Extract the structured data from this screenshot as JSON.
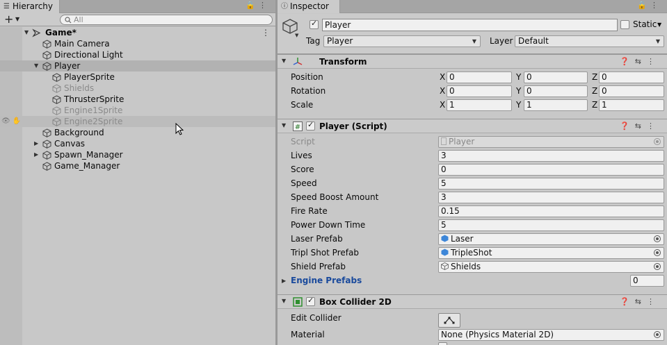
{
  "hierarchy": {
    "tab_label": "Hierarchy",
    "search_placeholder": "All",
    "scene": "Game*",
    "items": [
      {
        "label": "Main Camera"
      },
      {
        "label": "Directional Light"
      },
      {
        "label": "Player"
      },
      {
        "label": "PlayerSprite"
      },
      {
        "label": "Shields"
      },
      {
        "label": "ThrusterSprite"
      },
      {
        "label": "Engine1Sprite"
      },
      {
        "label": "Engine2Sprite"
      },
      {
        "label": "Background"
      },
      {
        "label": "Canvas"
      },
      {
        "label": "Spawn_Manager"
      },
      {
        "label": "Game_Manager"
      }
    ]
  },
  "inspector": {
    "tab_label": "Inspector",
    "object_name": "Player",
    "static_label": "Static",
    "tag_label": "Tag",
    "tag_value": "Player",
    "layer_label": "Layer",
    "layer_value": "Default",
    "transform": {
      "title": "Transform",
      "position_label": "Position",
      "rotation_label": "Rotation",
      "scale_label": "Scale",
      "axis_x": "X",
      "axis_y": "Y",
      "axis_z": "Z",
      "position": [
        "0",
        "0",
        "0"
      ],
      "rotation": [
        "0",
        "0",
        "0"
      ],
      "scale": [
        "1",
        "1",
        "1"
      ]
    },
    "player_script": {
      "title": "Player (Script)",
      "script_label": "Script",
      "script_value": "Player",
      "lives_label": "Lives",
      "lives": "3",
      "score_label": "Score",
      "score": "0",
      "speed_label": "Speed",
      "speed": "5",
      "speed_boost_label": "Speed Boost Amount",
      "speed_boost": "3",
      "fire_rate_label": "Fire Rate",
      "fire_rate": "0.15",
      "power_down_label": "Power Down Time",
      "power_down": "5",
      "laser_prefab_label": "Laser Prefab",
      "laser_prefab": "Laser",
      "tripl_shot_label": "Tripl Shot Prefab",
      "tripl_shot": "TripleShot",
      "shield_prefab_label": "Shield Prefab",
      "shield_prefab": "Shields",
      "engine_prefabs_label": "Engine Prefabs",
      "engine_prefabs_count": "0"
    },
    "box_collider": {
      "title": "Box Collider 2D",
      "edit_collider_label": "Edit Collider",
      "material_label": "Material",
      "material_value": "None (Physics Material 2D)"
    }
  }
}
